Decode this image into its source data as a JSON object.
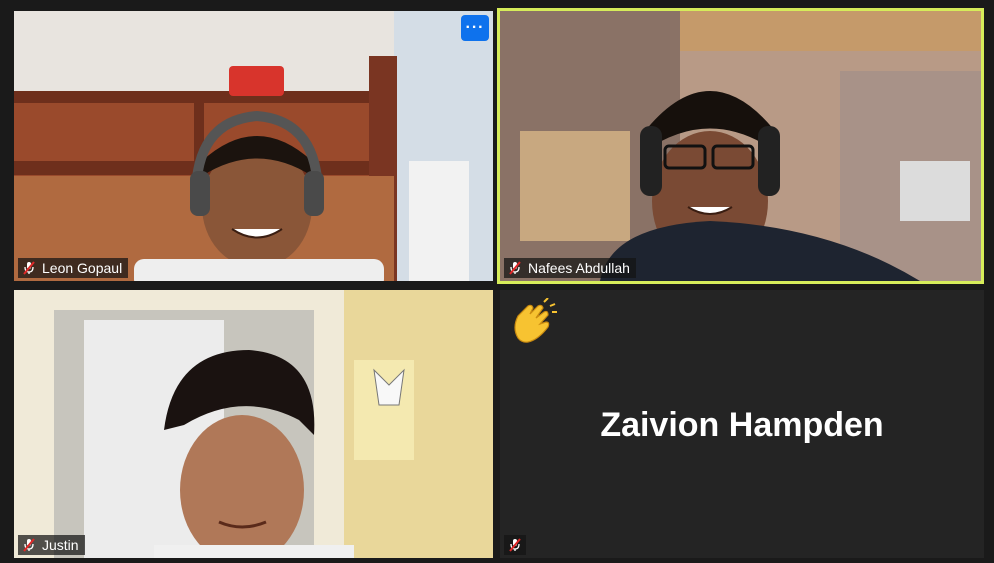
{
  "participants": [
    {
      "name": "Leon Gopaul",
      "muted": true,
      "video": true
    },
    {
      "name": "Nafees Abdullah",
      "muted": true,
      "video": true,
      "active_speaker": true
    },
    {
      "name": "Justin",
      "muted": true,
      "video": true
    },
    {
      "name": "Zaivion Hampden",
      "muted": true,
      "video": false,
      "reaction": "clapping-hands"
    }
  ],
  "more_button_label": "···",
  "colors": {
    "active_border": "#d6ec5a",
    "accent": "#0e72ed",
    "mute_icon": "#e02828"
  }
}
